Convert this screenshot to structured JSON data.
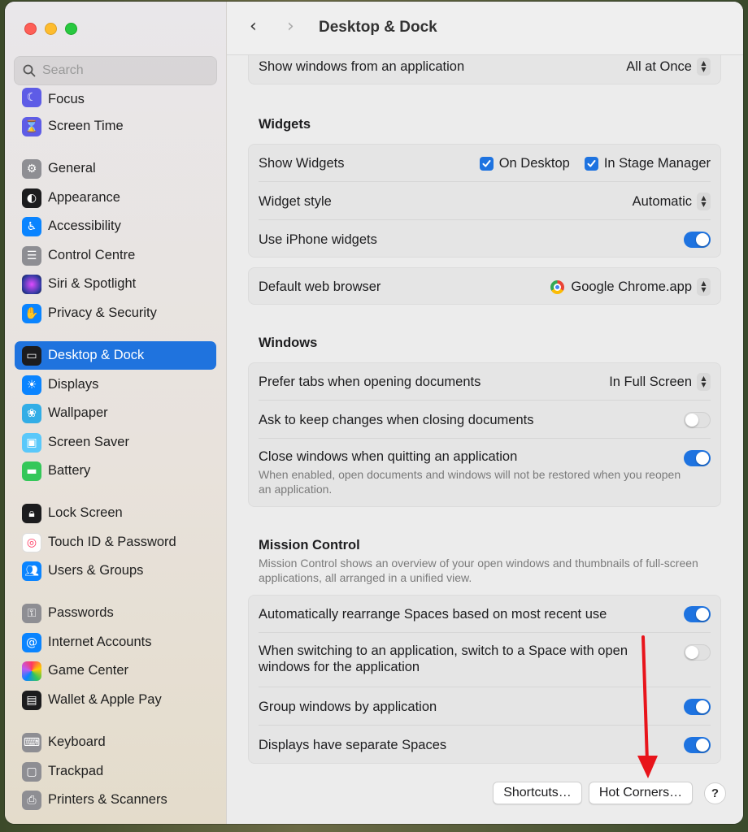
{
  "window": {
    "title": "Desktop & Dock"
  },
  "search": {
    "placeholder": "Search"
  },
  "sidebar": {
    "items": [
      {
        "label": "Focus",
        "icon": "moon-icon",
        "color": "#5e5ce6"
      },
      {
        "label": "Screen Time",
        "icon": "hourglass-icon",
        "color": "#5e5ce6"
      },
      {
        "label": "General",
        "icon": "gear-icon",
        "color": "#8e8e93"
      },
      {
        "label": "Appearance",
        "icon": "appearance-icon",
        "color": "#1c1c1e"
      },
      {
        "label": "Accessibility",
        "icon": "accessibility-icon",
        "color": "#0a84ff"
      },
      {
        "label": "Control Centre",
        "icon": "control-centre-icon",
        "color": "#8e8e93"
      },
      {
        "label": "Siri & Spotlight",
        "icon": "siri-icon",
        "color": "#3a3a8c"
      },
      {
        "label": "Privacy & Security",
        "icon": "hand-icon",
        "color": "#0a84ff"
      },
      {
        "label": "Desktop & Dock",
        "icon": "dock-icon",
        "color": "#1c1c1e"
      },
      {
        "label": "Displays",
        "icon": "sun-icon",
        "color": "#0a84ff"
      },
      {
        "label": "Wallpaper",
        "icon": "flower-icon",
        "color": "#32ade6"
      },
      {
        "label": "Screen Saver",
        "icon": "screen-saver-icon",
        "color": "#5ac8fa"
      },
      {
        "label": "Battery",
        "icon": "battery-icon",
        "color": "#34c759"
      },
      {
        "label": "Lock Screen",
        "icon": "lock-icon",
        "color": "#1c1c1e"
      },
      {
        "label": "Touch ID & Password",
        "icon": "fingerprint-icon",
        "color": "#ffffff"
      },
      {
        "label": "Users & Groups",
        "icon": "users-icon",
        "color": "#0a84ff"
      },
      {
        "label": "Passwords",
        "icon": "key-icon",
        "color": "#8e8e93"
      },
      {
        "label": "Internet Accounts",
        "icon": "at-icon",
        "color": "#0a84ff"
      },
      {
        "label": "Game Center",
        "icon": "game-center-icon",
        "color": "#ffffff"
      },
      {
        "label": "Wallet & Apple Pay",
        "icon": "wallet-icon",
        "color": "#1c1c1e"
      },
      {
        "label": "Keyboard",
        "icon": "keyboard-icon",
        "color": "#8e8e93"
      },
      {
        "label": "Trackpad",
        "icon": "trackpad-icon",
        "color": "#8e8e93"
      },
      {
        "label": "Printers & Scanners",
        "icon": "printer-icon",
        "color": "#8e8e93"
      }
    ]
  },
  "main": {
    "show_windows": {
      "label": "Show windows from an application",
      "value": "All at Once"
    },
    "widgets": {
      "title": "Widgets",
      "show_widgets": "Show Widgets",
      "on_desktop": "On Desktop",
      "in_stage_manager": "In Stage Manager",
      "widget_style": "Widget style",
      "widget_style_value": "Automatic",
      "use_iphone": "Use iPhone widgets"
    },
    "browser": {
      "label": "Default web browser",
      "value": "Google Chrome.app"
    },
    "windows": {
      "title": "Windows",
      "prefer_tabs": "Prefer tabs when opening documents",
      "prefer_tabs_value": "In Full Screen",
      "ask_keep": "Ask to keep changes when closing documents",
      "close_windows": "Close windows when quitting an application",
      "close_windows_desc": "When enabled, open documents and windows will not be restored when you reopen an application."
    },
    "mission_control": {
      "title": "Mission Control",
      "desc": "Mission Control shows an overview of your open windows and thumbnails of full-screen applications, all arranged in a unified view.",
      "auto_rearrange": "Automatically rearrange Spaces based on most recent use",
      "switch_space": "When switching to an application, switch to a Space with open windows for the application",
      "group_windows": "Group windows by application",
      "separate_spaces": "Displays have separate Spaces"
    },
    "buttons": {
      "shortcuts": "Shortcuts…",
      "hot_corners": "Hot Corners…",
      "help": "?"
    }
  },
  "toggles": {
    "use_iphone": true,
    "ask_keep": false,
    "close_windows": true,
    "auto_rearrange": true,
    "switch_space": false,
    "group_windows": true,
    "separate_spaces": true
  },
  "colors": {
    "accent": "#1e73e0",
    "annotation_arrow": "#e8141b"
  }
}
